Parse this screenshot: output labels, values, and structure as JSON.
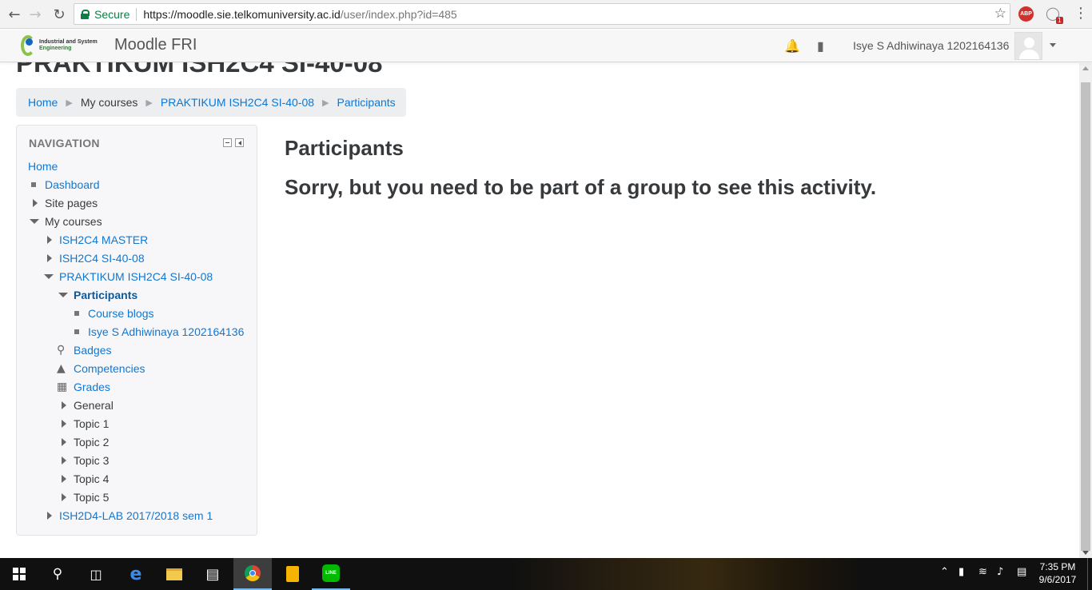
{
  "browser": {
    "secure_label": "Secure",
    "url_host": "https://moodle.sie.telkomuniversity.ac.id",
    "url_path": "/user/index.php?id=485",
    "abp_label": "ABP",
    "ext_badge": "1"
  },
  "header": {
    "logo_line1": "Industrial and System",
    "logo_line2": "Engineering",
    "site_name": "Moodle FRI",
    "user_name": "Isye S Adhiwinaya 1202164136"
  },
  "page": {
    "heading": "PRAKTIKUM ISH2C4 SI-40-08"
  },
  "breadcrumb": [
    {
      "label": "Home"
    },
    {
      "label": "My courses"
    },
    {
      "label": "PRAKTIKUM ISH2C4 SI-40-08"
    },
    {
      "label": "Participants"
    }
  ],
  "navigation": {
    "title": "NAVIGATION",
    "items": [
      {
        "label": "Home"
      },
      {
        "label": "Dashboard"
      },
      {
        "label": "Site pages"
      },
      {
        "label": "My courses"
      },
      {
        "label": "ISH2C4 MASTER"
      },
      {
        "label": "ISH2C4 SI-40-08"
      },
      {
        "label": "PRAKTIKUM ISH2C4 SI-40-08"
      },
      {
        "label": "Participants"
      },
      {
        "label": "Course blogs"
      },
      {
        "label": "Isye S Adhiwinaya 1202164136"
      },
      {
        "label": "Badges"
      },
      {
        "label": "Competencies"
      },
      {
        "label": "Grades"
      },
      {
        "label": "General"
      },
      {
        "label": "Topic 1"
      },
      {
        "label": "Topic 2"
      },
      {
        "label": "Topic 3"
      },
      {
        "label": "Topic 4"
      },
      {
        "label": "Topic 5"
      },
      {
        "label": "ISH2D4-LAB 2017/2018 sem 1"
      }
    ]
  },
  "main": {
    "title": "Participants",
    "message": "Sorry, but you need to be part of a group to see this activity."
  },
  "taskbar": {
    "time": "7:35 PM",
    "date": "9/6/2017",
    "line_label": "LINE"
  },
  "colors": {
    "link": "#1177d1",
    "secure": "#0b8043"
  }
}
